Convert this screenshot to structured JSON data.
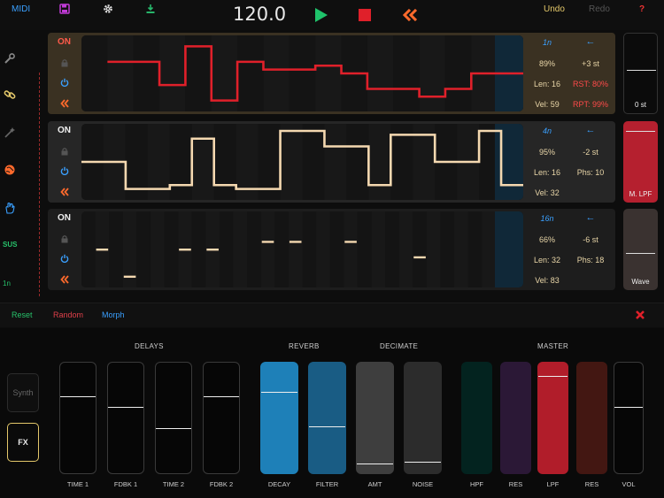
{
  "topbar": {
    "midi": "MIDI",
    "bpm": "120.0",
    "undo": "Undo",
    "redo": "Redo",
    "help": "?",
    "icons": [
      "save-icon",
      "gear-icon",
      "download-icon",
      "play-icon",
      "stop-icon",
      "rewind-icon"
    ],
    "colors": {
      "play": "#1fc36b",
      "stop": "#e0202a",
      "rewind": "#ff6a2c",
      "save": "#c03ad6",
      "download": "#27b56a"
    }
  },
  "rail": {
    "icons": [
      "wrench-icon",
      "link-icon",
      "wand-icon",
      "globe-icon",
      "hand-icon"
    ],
    "sus": "SUS",
    "note": "1n"
  },
  "tracks": [
    {
      "on_label": "ON",
      "color": "#e0202a",
      "rate": "1n",
      "arrow": "←",
      "prob": "89%",
      "transpose": "+3 st",
      "len": "Len: 16",
      "extra": "RST: 80%",
      "extra_red": true,
      "vel": "Vel: 59",
      "rpt": "RPT: 99%",
      "steps": [
        null,
        11,
        11,
        5,
        15,
        1,
        11,
        9,
        9,
        10,
        8,
        4,
        4,
        2,
        4,
        8,
        8
      ]
    },
    {
      "on_label": "ON",
      "color": "#f4d8b0",
      "rate": "4n",
      "arrow": "←",
      "prob": "95%",
      "transpose": "-2 st",
      "len": "Len: 16",
      "extra": "Phs: 10",
      "extra_red": false,
      "vel": "Vel: 32",
      "rpt": "",
      "steps": [
        8,
        8,
        1,
        1,
        2,
        14,
        2,
        1,
        1,
        16,
        16,
        12,
        12,
        2,
        15,
        15,
        8,
        8,
        16,
        2
      ]
    },
    {
      "on_label": "ON",
      "color": "#f4d8b0",
      "rate": "16n",
      "arrow": "←",
      "prob": "66%",
      "transpose": "-6 st",
      "len": "Len: 32",
      "extra": "Phs: 18",
      "extra_red": false,
      "vel": "Vel: 83",
      "rpt": "",
      "steps": [
        null,
        8,
        null,
        1,
        null,
        null,
        null,
        8,
        null,
        8,
        null,
        null,
        null,
        10,
        null,
        10,
        null,
        null,
        null,
        10,
        null,
        null,
        null,
        null,
        6,
        null,
        null,
        null,
        null,
        null,
        null,
        null
      ]
    }
  ],
  "side_panels": [
    {
      "label": "0 st",
      "level": 0.55
    },
    {
      "label": "M. LPF",
      "level": 0.88
    },
    {
      "label": "Wave",
      "level": 0.45
    }
  ],
  "strip": {
    "reset": "Reset",
    "random": "Random",
    "morph": "Morph",
    "close_icon": "close-icon"
  },
  "mixer": {
    "mode_synth": "Synth",
    "mode_fx": "FX",
    "groups": {
      "delays": "DELAYS",
      "reverb": "REVERB",
      "decimate": "DECIMATE",
      "master": "MASTER"
    },
    "faders": [
      {
        "label": "TIME 1",
        "level": 0.69,
        "fill": "none"
      },
      {
        "label": "FDBK 1",
        "level": 0.59,
        "fill": "none"
      },
      {
        "label": "TIME 2",
        "level": 0.4,
        "fill": "none"
      },
      {
        "label": "FDBK 2",
        "level": 0.69,
        "fill": "none"
      },
      {
        "label": "DECAY",
        "level": 0.73,
        "fill": "#1e80b8"
      },
      {
        "label": "FILTER",
        "level": 0.42,
        "fill": "#195c84"
      },
      {
        "label": "AMT",
        "level": 0.08,
        "fill": "#3e3e3e"
      },
      {
        "label": "NOISE",
        "level": 0.1,
        "fill": "#2c2c2c"
      },
      {
        "label": "HPF",
        "level": 0.0,
        "fill": "#03231f"
      },
      {
        "label": "RES",
        "level": 0.0,
        "fill": "#2b1836"
      },
      {
        "label": "LPF",
        "level": 0.87,
        "fill": "#b11d2a"
      },
      {
        "label": "RES",
        "level": 0.0,
        "fill": "#431712"
      },
      {
        "label": "VOL",
        "level": 0.59,
        "fill": "none"
      }
    ]
  }
}
